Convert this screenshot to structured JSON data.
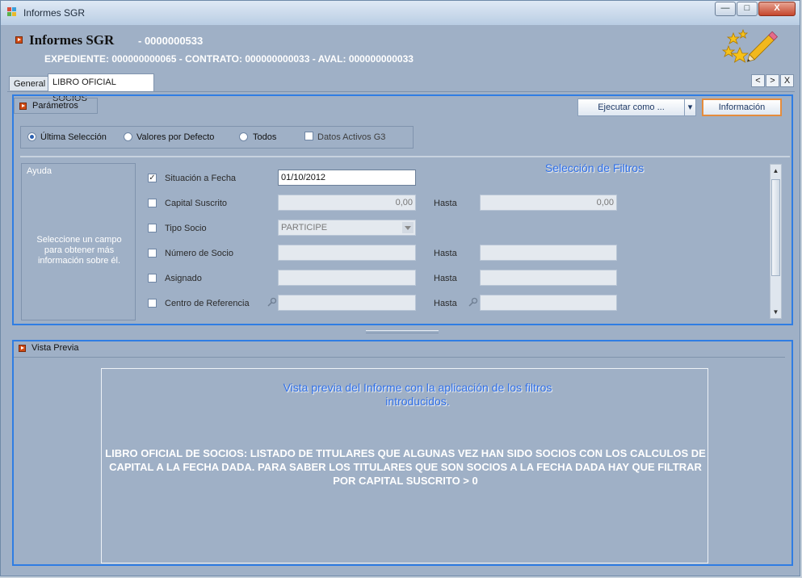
{
  "window": {
    "title": "Informes SGR",
    "minimize_label": "—",
    "maximize_label": "□",
    "close_label": "X"
  },
  "header": {
    "title": "Informes SGR",
    "code": "- 0000000533",
    "subtitle": "EXPEDIENTE: 000000000065 - CONTRATO: 000000000033 - AVAL: 000000000033"
  },
  "tabs": [
    {
      "label": "General",
      "active": false
    },
    {
      "label": "LIBRO OFICIAL SOCIOS",
      "active": true
    }
  ],
  "tab_nav": {
    "prev": "<",
    "next": ">",
    "close": "X"
  },
  "parametros": {
    "title": "Parámetros",
    "execute_button": "Ejecutar como ...",
    "execute_dropdown": "▾",
    "info_button": "Información",
    "radios": [
      {
        "label": "Última Selección",
        "selected": true
      },
      {
        "label": "Valores por Defecto",
        "selected": false
      },
      {
        "label": "Todos",
        "selected": false
      }
    ],
    "checkbox_active": {
      "label": "Datos Activos G3",
      "checked": false
    }
  },
  "help": {
    "title": "Ayuda",
    "text": "Seleccione un campo para obtener más información sobre él."
  },
  "filters": {
    "hasta_label": "Hasta",
    "rows": [
      {
        "label": "Situación a Fecha",
        "checked": true,
        "value": "01/10/2012",
        "to": null
      },
      {
        "label": "Capital Suscrito",
        "checked": false,
        "value": "0,00",
        "to": "0,00"
      },
      {
        "label": "Tipo Socio",
        "checked": false,
        "value": "PARTICIPE",
        "to": null
      },
      {
        "label": "Número de Socio",
        "checked": false,
        "value": "",
        "to": ""
      },
      {
        "label": "Asignado",
        "checked": false,
        "value": "",
        "to": ""
      },
      {
        "label": "Centro de Referencia",
        "checked": false,
        "value": "",
        "to": ""
      }
    ]
  },
  "annotations": {
    "filters": "Selección de Filtros",
    "preview": "Vista previa del Informe con la aplicación de los filtros introducidos."
  },
  "preview": {
    "title": "Vista Previa",
    "text": "LIBRO OFICIAL DE SOCIOS: LISTADO DE TITULARES QUE ALGUNAS VEZ HAN SIDO SOCIOS CON LOS CALCULOS DE CAPITAL A LA FECHA DADA. PARA SABER LOS TITULARES QUE SON SOCIOS A LA FECHA DADA HAY QUE FILTRAR POR CAPITAL SUSCRITO > 0"
  },
  "colors": {
    "accent": "#2f7de3",
    "bullet": "#d04b15",
    "panel": "#9fb0c6"
  }
}
